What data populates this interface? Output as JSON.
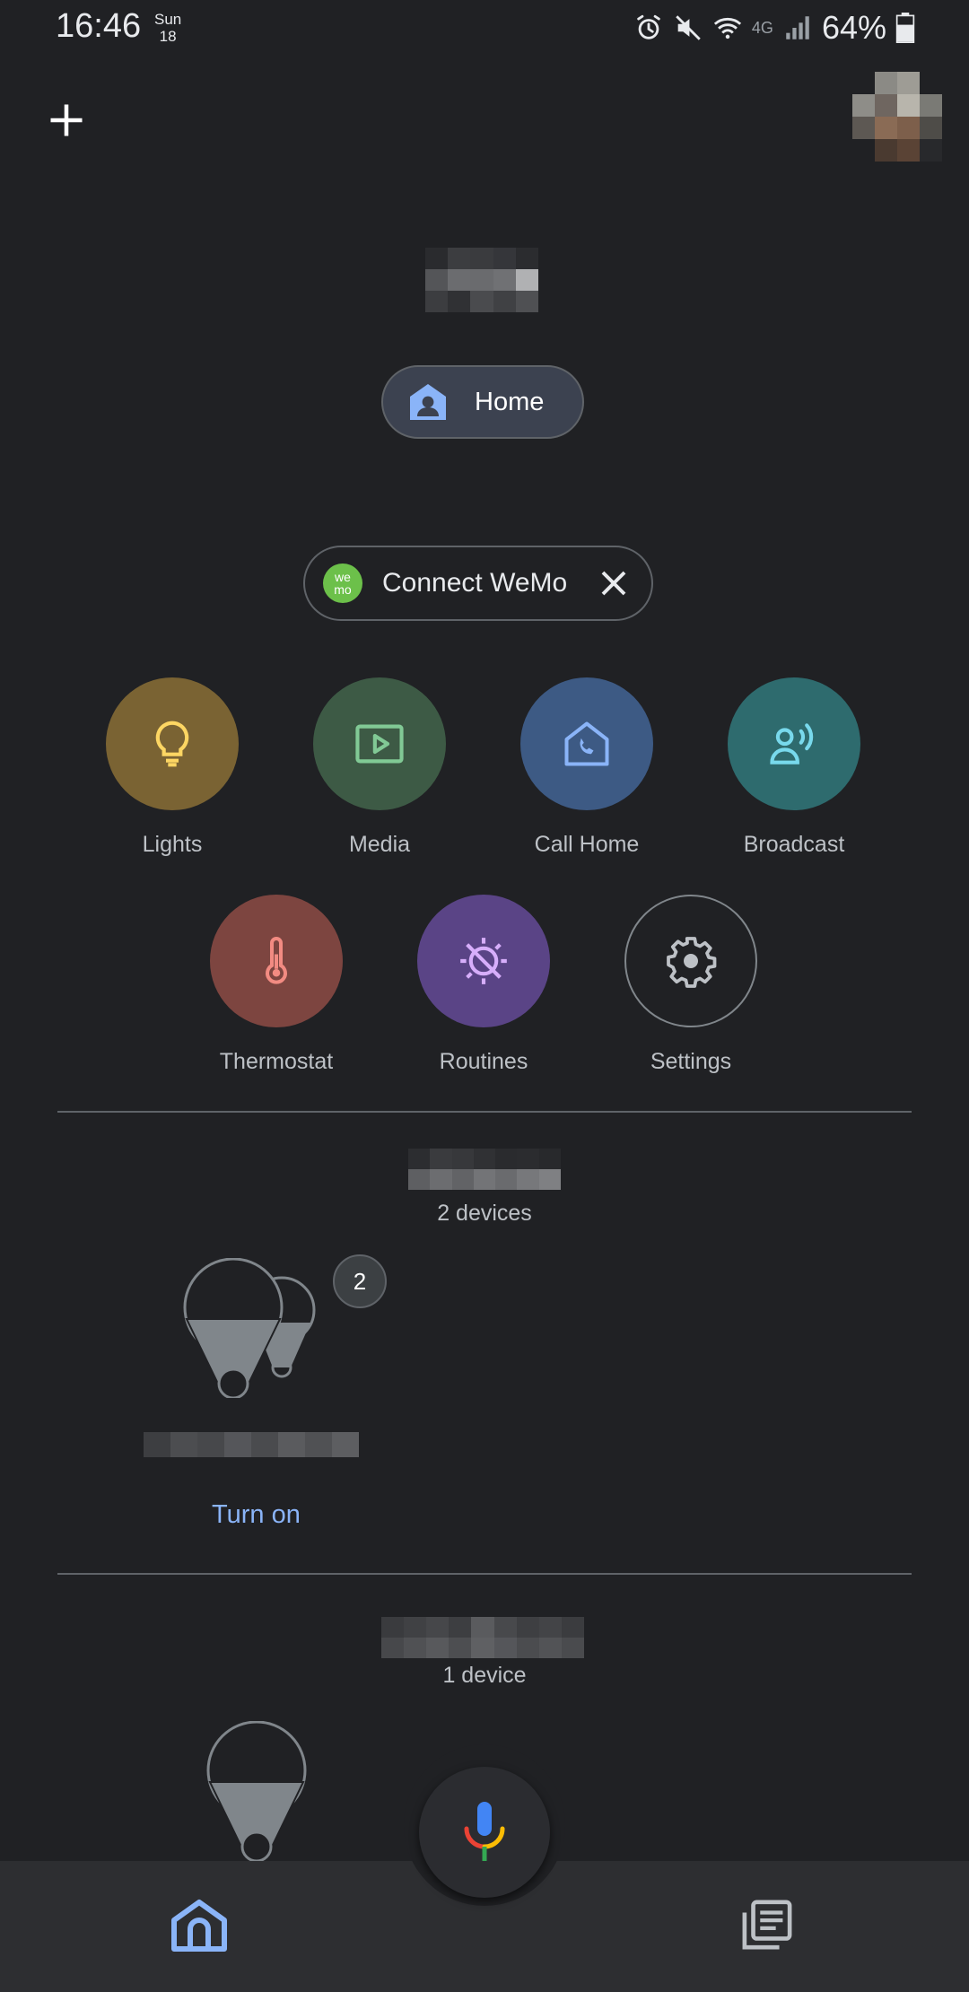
{
  "status_bar": {
    "time": "16:46",
    "day": "Sun",
    "date": "18",
    "network": "4G",
    "battery": "64%"
  },
  "header": {
    "add_icon": "plus-icon",
    "home_chip_label": "Home"
  },
  "wemo_chip": {
    "logo_top": "we",
    "logo_bottom": "mo",
    "label": "Connect WeMo",
    "close_icon": "close-icon"
  },
  "shortcuts": [
    {
      "label": "Lights",
      "icon": "lightbulb-icon",
      "color": "#7a6333"
    },
    {
      "label": "Media",
      "icon": "media-play-icon",
      "color": "#3d5a45"
    },
    {
      "label": "Call Home",
      "icon": "call-home-icon",
      "color": "#3d5a84"
    },
    {
      "label": "Broadcast",
      "icon": "broadcast-icon",
      "color": "#2e6b6e"
    },
    {
      "label": "Thermostat",
      "icon": "thermometer-icon",
      "color": "#7d4540"
    },
    {
      "label": "Routines",
      "icon": "routines-icon",
      "color": "#5a4486"
    },
    {
      "label": "Settings",
      "icon": "gear-icon",
      "color": "#202124"
    }
  ],
  "rooms": [
    {
      "device_count": "2 devices",
      "badge": "2",
      "action": "Turn on"
    },
    {
      "device_count": "1 device"
    }
  ],
  "bottom_nav": {
    "home_icon": "home-icon",
    "feed_icon": "feed-icon",
    "mic_icon": "mic-icon"
  },
  "colors": {
    "background": "#202124",
    "accent_blue": "#8ab4f8",
    "bottom_nav": "#2d2e31"
  }
}
